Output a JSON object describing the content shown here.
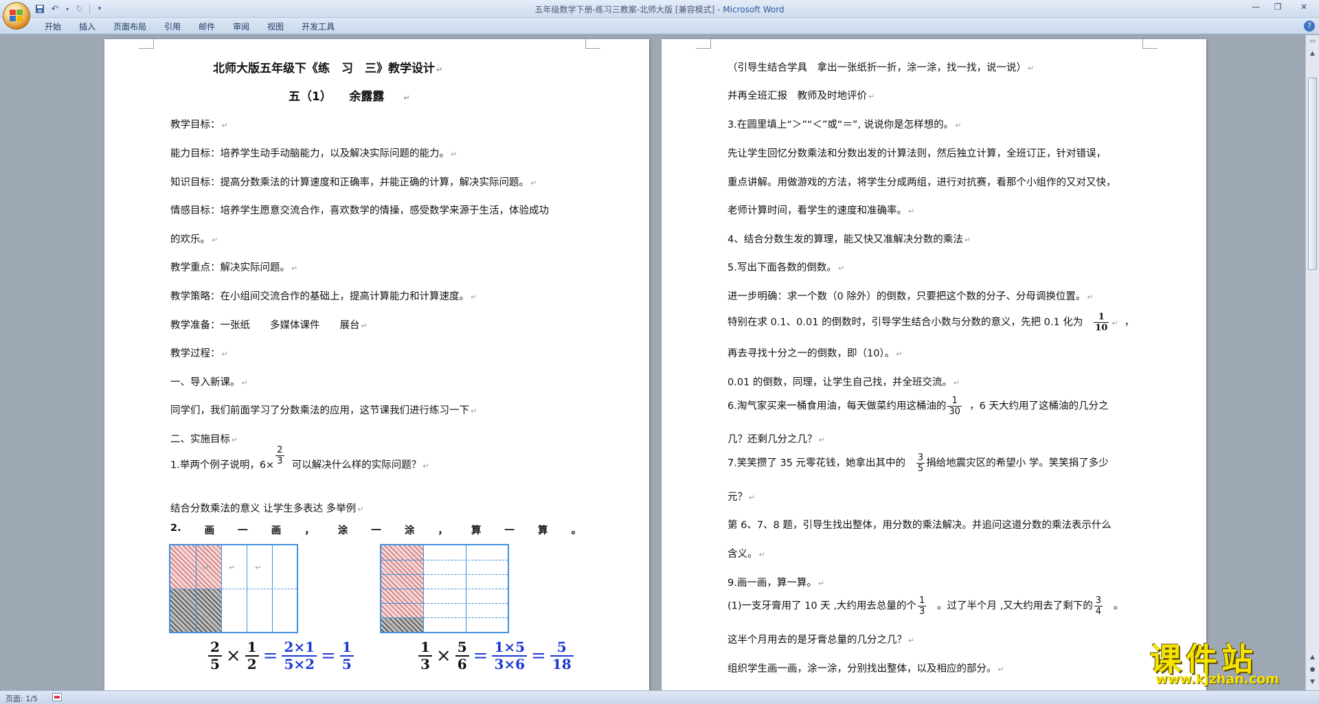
{
  "window": {
    "title_doc": "五年级数学下册-练习三教案-北师大版 [兼容模式]",
    "title_sep": " - ",
    "title_app": "Microsoft Word",
    "minimize": "—",
    "maximize": "❐",
    "close": "✕"
  },
  "ribbon": {
    "tabs": [
      "开始",
      "插入",
      "页面布局",
      "引用",
      "邮件",
      "审阅",
      "视图",
      "开发工具"
    ],
    "help": "?"
  },
  "page1": {
    "title": "北师大版五年级下《练　习　三》教学设计",
    "author": "五（1）　　余露露",
    "lines": [
      "教学目标：",
      "能力目标：培养学生动手动脑能力，以及解决实际问题的能力。",
      "知识目标：提高分数乘法的计算速度和正确率，并能正确的计算，解决实际问题。",
      "情感目标：培养学生愿意交流合作，喜欢数学的情操，感受数学来源于生活，体验成功",
      "的欢乐。",
      "教学重点：解决实际问题。",
      "教学策略：在小组间交流合作的基础上，提高计算能力和计算速度。",
      "教学准备：一张纸　　多媒体课件　　展台",
      "教学过程：",
      "一、导入新课。",
      "同学们，我们前面学习了分数乘法的应用，这节课我们进行练习一下",
      "二、实施目标"
    ],
    "q1_before": "1.举两个例子说明，6×",
    "q1_frac": {
      "num": "2",
      "den": "3"
    },
    "q1_after": "可以解决什么样的实际问题？",
    "line_after_q1": "结合分数乘法的意义 让学生多表达 多举例",
    "q2_chars": [
      "2.",
      "画",
      "一",
      "画",
      "，",
      "涂",
      "一",
      "涂",
      "，",
      "算",
      "一",
      "算",
      "。"
    ],
    "eq1": {
      "a": {
        "num": "2",
        "den": "5"
      },
      "b": {
        "num": "1",
        "den": "2"
      },
      "c": {
        "num": "2×1",
        "den": "5×2"
      },
      "d": {
        "num": "1",
        "den": "5"
      },
      "times": "×",
      "eq": "="
    },
    "eq2": {
      "a": {
        "num": "1",
        "den": "3"
      },
      "b": {
        "num": "5",
        "den": "6"
      },
      "c": {
        "num": "1×5",
        "den": "3×6"
      },
      "d": {
        "num": "5",
        "den": "18"
      },
      "times": "×",
      "eq": "="
    }
  },
  "page2": {
    "lines": [
      "（引导生结合学具　拿出一张纸折一折，涂一涂，找一找，说一说）",
      "并再全班汇报　教师及时地评价",
      "3.在圆里填上“＞”“＜”或“＝”, 说说你是怎样想的。",
      "先让学生回忆分数乘法和分数出发的计算法则，然后独立计算，全班订正，针对错误，",
      "重点讲解。用做游戏的方法，将学生分成两组，进行对抗赛，看那个小组作的又对又快，",
      "老师计算时间，看学生的速度和准确率。",
      "4、结合分数生发的算理，能又快又准解决分数的乘法",
      "5.写出下面各数的倒数。",
      "进一步明确：求一个数（0 除外）的倒数，只要把这个数的分子、分母调换位置。"
    ],
    "line_01_before": "特别在求 0.1、0.01 的倒数时，引导学生结合小数与分数的意义，先把 0.1 化为",
    "line_01_frac": {
      "num": "1",
      "den": "10"
    },
    "line_01_after": "，",
    "line_10": "再去寻找十分之一的倒数，即（10）。",
    "line_001": "0.01 的倒数，同理，让学生自己找，并全班交流。",
    "q6_before": "6.淘气家买来一桶食用油，每天做菜约用这桶油的",
    "q6_frac": {
      "num": "1",
      "den": "30"
    },
    "q6_after": "，6 天大约用了这桶油的几分之",
    "q6_line2": "几？还剩几分之几？",
    "q7_before": "7.笑笑攒了 35 元零花钱，她拿出其中的",
    "q7_frac": {
      "num": "3",
      "den": "5"
    },
    "q7_after": "捐给地震灾区的希望小 学。笑笑捐了多少",
    "q7_line2": "元？",
    "q678": "第 6、7、8 题，引导生找出整体，用分数的乘法解决。并追问这道分数的乘法表示什么",
    "q678_line2": "含义。",
    "q9": "9.画一画，算一算。",
    "q9a_before": "(1)一支牙膏用了 10 天 ,大约用去总量的个",
    "q9a_frac1": {
      "num": "1",
      "den": "3"
    },
    "q9a_mid": "。过了半个月 ,又大约用去了剩下的",
    "q9a_frac2": {
      "num": "3",
      "den": "4"
    },
    "q9a_end": "。",
    "q9a_line2": "这半个月用去的是牙膏总量的几分之几？",
    "last": "组织学生画一画，涂一涂，分别找出整体，以及相应的部分。"
  },
  "status": {
    "page": "页面: 1/5"
  },
  "watermark": {
    "title": "课件站",
    "url": "www.kjzhan.com"
  },
  "colors": {
    "grid": "#3f8fe0",
    "equation_blue": "#1a36d6",
    "watermark": "#f7e300"
  }
}
